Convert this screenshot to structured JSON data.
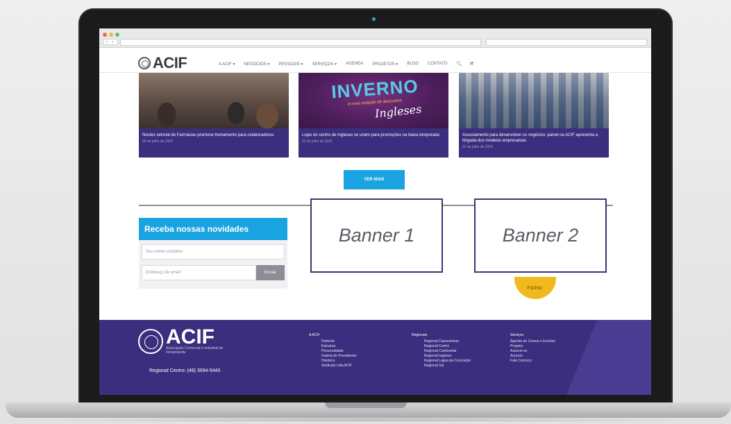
{
  "browser": {
    "nav_arrows": "‹ ›"
  },
  "site": {
    "logo_text": "ACIF",
    "nav": [
      {
        "label": "A ACIF",
        "has_caret": true
      },
      {
        "label": "NEGÓCIOS",
        "has_caret": true
      },
      {
        "label": "PESSOAIS",
        "has_caret": true
      },
      {
        "label": "SERVIÇOS",
        "has_caret": true
      },
      {
        "label": "AGENDA",
        "has_caret": false
      },
      {
        "label": "PROJETOS",
        "has_caret": true
      },
      {
        "label": "BLOG",
        "has_caret": false
      },
      {
        "label": "CONTATO",
        "has_caret": false
      }
    ],
    "nav_icons": [
      "search-icon",
      "wrench-icon"
    ]
  },
  "news": [
    {
      "title": "Núcleo setorial de Farmácias promove treinamento para colaboradores",
      "date": "25 de julho de 2016"
    },
    {
      "title": "Lojas do centro de Inglesas se unem para promoções na baixa temporada",
      "date": "22 de julho de 2016",
      "image_text": {
        "headline": "INVERNO",
        "sub": "é nova estação de descontos",
        "script": "Ingleses"
      }
    },
    {
      "title": "Associamento para desenvolver os negócios: painel na ACIF apresenta a fórgada dos modelos empresariais",
      "date": "22 de julho de 2016"
    }
  ],
  "ver_mais": "VER MAIS",
  "newsletter": {
    "title": "Receba nossas novidades",
    "name_placeholder": "Seu nome completo",
    "email_placeholder": "Endereço de email",
    "send_label": "Enviar"
  },
  "banners": [
    "Banner 1",
    "Banner 2"
  ],
  "badge_text": "FOPAI",
  "footer": {
    "logo_text": "ACIF",
    "logo_sub": "Associação Comercial e Industrial de Florianópolis",
    "phone": "Regional Centro: (48) 3094-5440",
    "columns": [
      {
        "title": "A ACIF",
        "items": [
          "Diretoria",
          "Estrutura",
          "Personalidade",
          "Galeria de Presidentes",
          "Histórico",
          "Sindicato Ltda ACIF"
        ]
      },
      {
        "title": "Regionais",
        "items": [
          "Regional Canasvieiras",
          "Regional Centro",
          "Regional Continental",
          "Regional Ingleses",
          "Regional Lagoa da Conceição",
          "Regional Sul"
        ]
      },
      {
        "title": "Serviços",
        "items": [
          "Agenda de Cursos e Eventos",
          "Projetos",
          "Associe-se",
          "Anuncie",
          "Fale Conosco"
        ]
      }
    ]
  },
  "colors": {
    "brand_purple": "#3b2e7e",
    "brand_blue": "#1aa3e1",
    "laptop_bezel": "#1b1b1c"
  }
}
